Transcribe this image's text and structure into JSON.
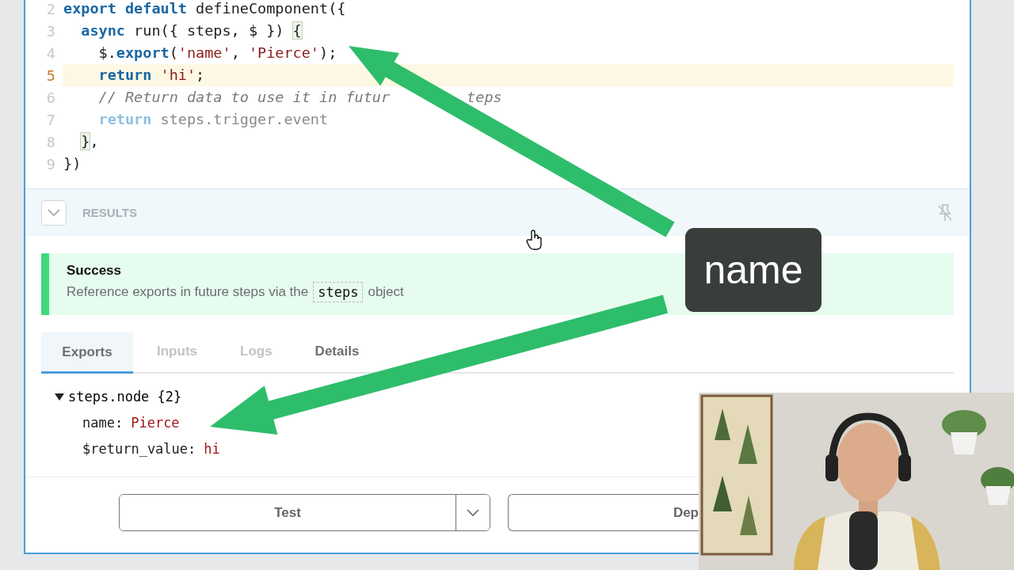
{
  "editor": {
    "lines": [
      {
        "number": "2",
        "current": false,
        "tokens": [
          {
            "kind": "keyword",
            "text": "export default"
          },
          {
            "kind": "plain",
            "text": " defineComponent({"
          }
        ]
      },
      {
        "number": "3",
        "current": false,
        "tokens": [
          {
            "kind": "keyword",
            "text": "  async"
          },
          {
            "kind": "plain",
            "text": " run({ steps, $ }) "
          },
          {
            "kind": "bracket",
            "text": "{"
          }
        ]
      },
      {
        "number": "4",
        "current": false,
        "tokens": [
          {
            "kind": "plain",
            "text": "    $."
          },
          {
            "kind": "keyword",
            "text": "export"
          },
          {
            "kind": "plain",
            "text": "("
          },
          {
            "kind": "string",
            "text": "'name'"
          },
          {
            "kind": "plain",
            "text": ", "
          },
          {
            "kind": "string",
            "text": "'Pierce'"
          },
          {
            "kind": "plain",
            "text": ");"
          }
        ]
      },
      {
        "number": "5",
        "current": true,
        "tokens": [
          {
            "kind": "keyword",
            "text": "    return"
          },
          {
            "kind": "string",
            "text": " 'hi'"
          },
          {
            "kind": "plain",
            "text": ";"
          }
        ]
      },
      {
        "number": "6",
        "current": false,
        "tokens": [
          {
            "kind": "comment",
            "text": "    // Return data to use it in futur"
          },
          {
            "kind": "comment-resume",
            "text": "teps"
          }
        ]
      },
      {
        "number": "7",
        "current": false,
        "tokens": [
          {
            "kind": "faded-keyword",
            "text": "    return"
          },
          {
            "kind": "faded",
            "text": " steps.trigger.event"
          }
        ]
      },
      {
        "number": "8",
        "current": false,
        "tokens": [
          {
            "kind": "bracket",
            "text": "  }"
          },
          {
            "kind": "plain",
            "text": ","
          }
        ]
      },
      {
        "number": "9",
        "current": false,
        "tokens": [
          {
            "kind": "plain",
            "text": "})"
          }
        ]
      }
    ]
  },
  "results": {
    "title": "RESULTS",
    "expanded": true
  },
  "success": {
    "title": "Success",
    "text_before": "Reference exports in future steps via the",
    "code": "steps",
    "text_after": "object"
  },
  "tabs": [
    {
      "label": "Exports",
      "selected": true,
      "disabled": false
    },
    {
      "label": "Inputs",
      "selected": false,
      "disabled": true
    },
    {
      "label": "Logs",
      "selected": false,
      "disabled": true
    },
    {
      "label": "Details",
      "selected": false,
      "disabled": false
    }
  ],
  "tree": {
    "label": "steps.node {2}",
    "expanded": true,
    "children": [
      {
        "key": "name:",
        "value": "Pierce"
      },
      {
        "key": "$return_value:",
        "value": "hi"
      }
    ]
  },
  "buttons": {
    "test": "Test",
    "deploy": "Dep"
  },
  "callout": {
    "text": "name"
  }
}
